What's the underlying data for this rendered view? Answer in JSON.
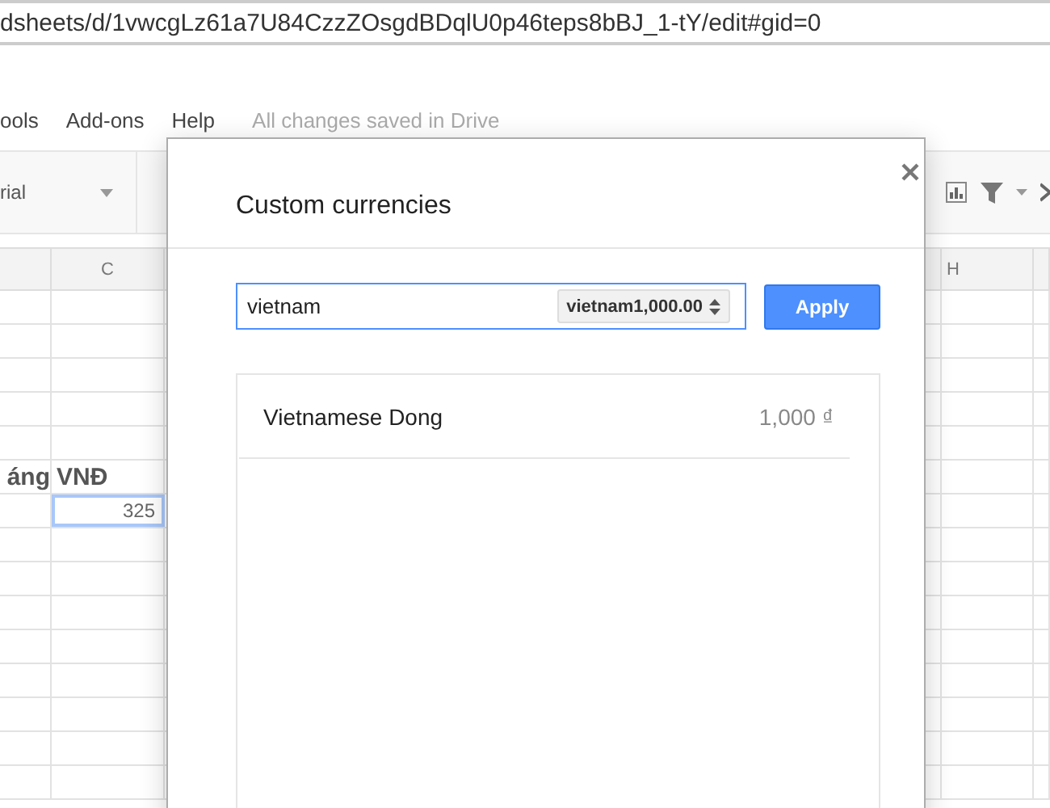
{
  "address_bar": {
    "url": "dsheets/d/1vwcgLz61a7U84CzzZOsgdBDqlU0p46teps8bBJ_1-tY/edit#gid=0"
  },
  "menu": [
    {
      "label": "ools"
    },
    {
      "label": "Add-ons"
    },
    {
      "label": "Help"
    }
  ],
  "save_status": "All changes saved in Drive",
  "toolbar": {
    "font": "rial"
  },
  "sheet": {
    "column_headers": [
      "C",
      "H"
    ],
    "label_row": {
      "col_b": "áng",
      "col_c": "VNĐ"
    },
    "value_row": {
      "col_c": "325",
      "selected": true
    }
  },
  "dialog": {
    "title": "Custom currencies",
    "search": {
      "value": "vietnam"
    },
    "format_select": "vietnam1,000.00",
    "apply_button": "Apply",
    "results": [
      {
        "name": "Vietnamese Dong",
        "sample": "1,000 ₫"
      }
    ]
  }
}
